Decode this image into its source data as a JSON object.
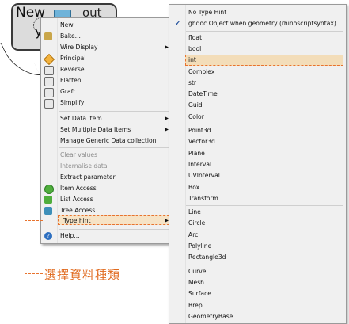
{
  "component": {
    "input_label": "New",
    "input_label_2": "y",
    "output_label": "out"
  },
  "menu": {
    "items": [
      {
        "label": "New",
        "icon": ""
      },
      {
        "label": "Bake...",
        "icon": "bake-icon"
      },
      {
        "label": "Wire Display",
        "icon": "",
        "submenu": true
      },
      {
        "label": "Principal",
        "icon": "principal-icon"
      },
      {
        "label": "Reverse",
        "icon": "reverse-icon"
      },
      {
        "label": "Flatten",
        "icon": "flatten-icon"
      },
      {
        "label": "Graft",
        "icon": "graft-icon"
      },
      {
        "label": "Simplify",
        "icon": "simplify-icon"
      },
      {
        "label": "Set Data Item",
        "icon": "",
        "submenu": true
      },
      {
        "label": "Set Multiple Data Items",
        "icon": "",
        "submenu": true
      },
      {
        "label": "Manage Generic Data collection",
        "icon": ""
      },
      {
        "label": "Clear values",
        "icon": "",
        "disabled": true
      },
      {
        "label": "Internalise data",
        "icon": "",
        "disabled": true
      },
      {
        "label": "Extract parameter",
        "icon": ""
      },
      {
        "label": "Item Access",
        "icon": "item-access-icon"
      },
      {
        "label": "List Access",
        "icon": "list-access-icon"
      },
      {
        "label": "Tree Access",
        "icon": "tree-access-icon"
      },
      {
        "label": "Type hint",
        "icon": "",
        "submenu": true,
        "highlighted": true
      },
      {
        "label": "Help...",
        "icon": "help-icon"
      }
    ]
  },
  "submenu": {
    "items": [
      {
        "label": "No Type Hint"
      },
      {
        "label": "ghdoc Object when geometry (rhinoscriptsyntax)",
        "checked": true
      },
      {
        "label": "float"
      },
      {
        "label": "bool"
      },
      {
        "label": "int",
        "highlighted": true
      },
      {
        "label": "Complex"
      },
      {
        "label": "str"
      },
      {
        "label": "DateTime"
      },
      {
        "label": "Guid"
      },
      {
        "label": "Color"
      },
      {
        "label": "Point3d"
      },
      {
        "label": "Vector3d"
      },
      {
        "label": "Plane"
      },
      {
        "label": "Interval"
      },
      {
        "label": "UVInterval"
      },
      {
        "label": "Box"
      },
      {
        "label": "Transform"
      },
      {
        "label": "Line"
      },
      {
        "label": "Circle"
      },
      {
        "label": "Arc"
      },
      {
        "label": "Polyline"
      },
      {
        "label": "Rectangle3d"
      },
      {
        "label": "Curve"
      },
      {
        "label": "Mesh"
      },
      {
        "label": "Surface"
      },
      {
        "label": "Brep"
      },
      {
        "label": "GeometryBase"
      }
    ]
  },
  "annotation": {
    "text": "選擇資料種類",
    "color": "#e06a1e"
  },
  "colors": {
    "highlight_border": "#e8732e",
    "check_color": "#1f4e9b"
  }
}
